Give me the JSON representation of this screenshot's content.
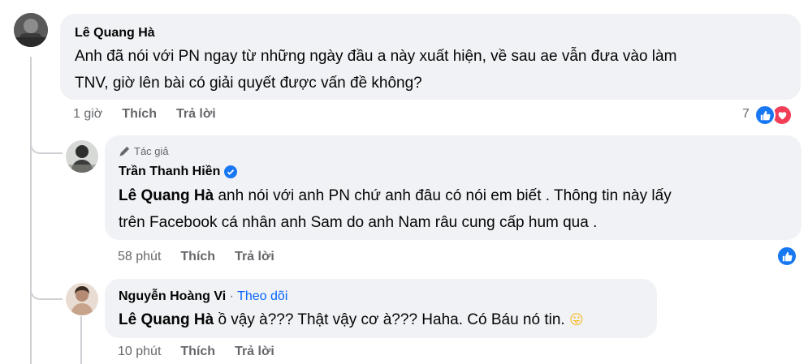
{
  "comments": [
    {
      "author": "Lê Quang Hà",
      "text": "Anh đã nói với PN ngay từ những ngày đầu a này xuất hiện, về sau ae vẫn đưa vào làm TNV, giờ lên bài có giải quyết được vấn đề không?",
      "text_line1": "Anh đã nói với PN ngay từ những ngày đầu a này xuất hiện, về sau ae vẫn đưa vào làm",
      "text_line2": "TNV, giờ lên bài có giải quyết được vấn đề không?",
      "time": "1 giờ",
      "like_label": "Thích",
      "reply_label": "Trả lời",
      "reaction_count": "7",
      "reactions": [
        "like-icon",
        "love-icon"
      ]
    },
    {
      "badge": "Tác giả",
      "author": "Trần Thanh Hiền",
      "verified": true,
      "mention": "Lê Quang Hà",
      "text_line1": " anh nói với anh PN chứ anh đâu có nói em biết . Thông tin này lấy",
      "text_line2": "trên Facebook cá nhân anh Sam do anh Nam râu cung cấp hum qua .",
      "time": "58 phút",
      "like_label": "Thích",
      "reply_label": "Trả lời",
      "reactions": [
        "like-icon"
      ]
    },
    {
      "author": "Nguyễn Hoàng Vi",
      "separator": " · ",
      "follow_label": "Theo dõi",
      "mention": "Lê Quang Hà",
      "text": " ồ vậy à??? Thật vậy cơ à??? Haha. Có Báu nó tin. ",
      "emoji": "😛",
      "time": "10 phút",
      "like_label": "Thích",
      "reply_label": "Trả lời"
    }
  ],
  "colors": {
    "bubble": "#f0f2f5",
    "meta": "#65676b",
    "link": "#0866ff",
    "like": "#1877f2",
    "love": "#f33e58",
    "thread_line": "#ced0d4"
  }
}
